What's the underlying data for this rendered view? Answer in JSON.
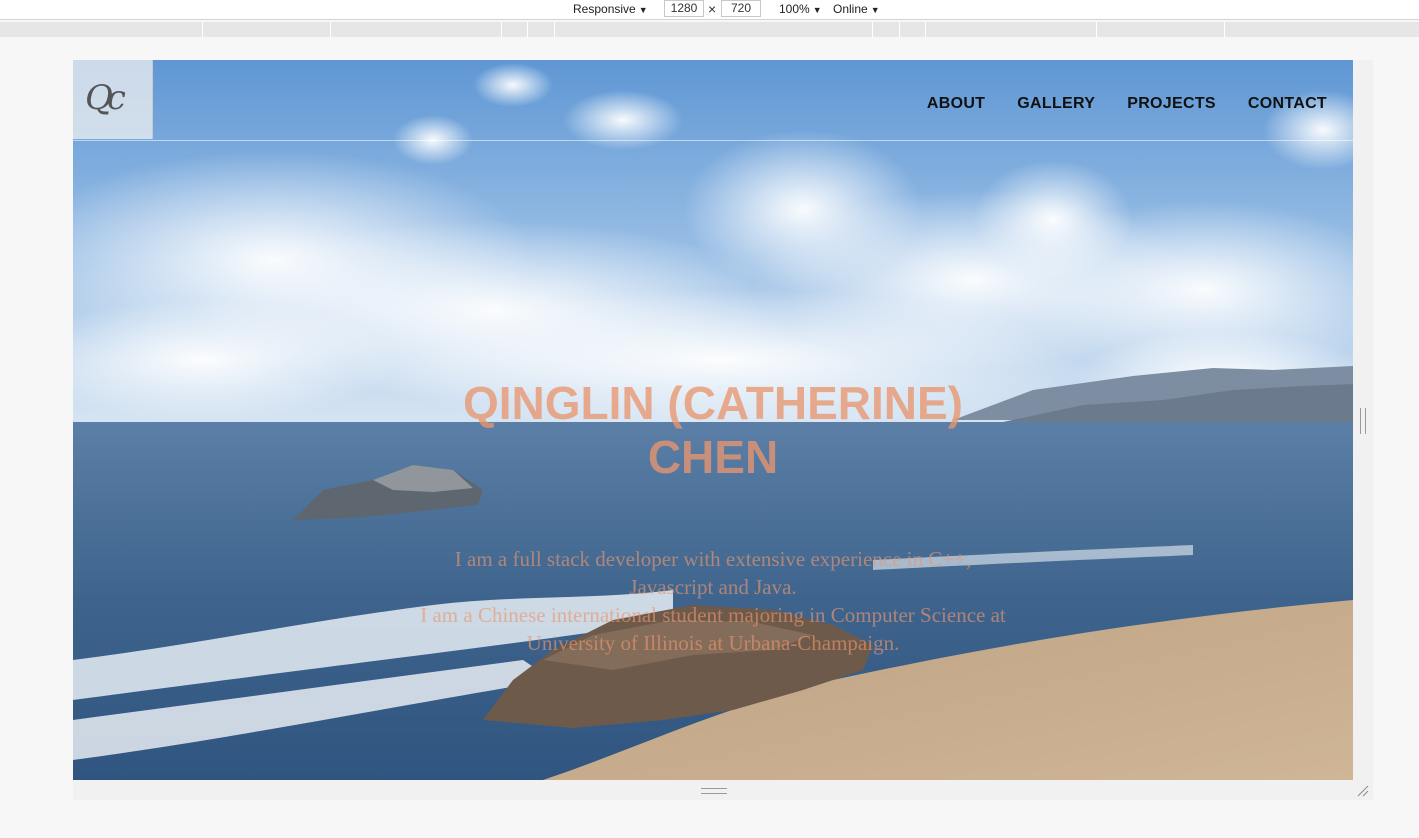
{
  "devtools": {
    "device": "Responsive",
    "width": "1280",
    "times": "×",
    "height": "720",
    "zoom": "100%",
    "network": "Online",
    "caret": "▼"
  },
  "site": {
    "logo_text": "Qc",
    "nav": [
      {
        "label": "ABOUT"
      },
      {
        "label": "GALLERY"
      },
      {
        "label": "PROJECTS"
      },
      {
        "label": "CONTACT"
      }
    ],
    "hero": {
      "title_line1": "QINGLIN (CATHERINE)",
      "title_line2": "CHEN",
      "lines": [
        "I am a full stack developer with extensive experience in C++,",
        "Javascript and Java.",
        "I am a Chinese international student majoring in Computer Science at",
        "University of Illinois at Urbana-Champaign."
      ]
    }
  },
  "colors": {
    "title": "#e8966e",
    "sky": "#6fa3d8",
    "ocean": "#3f6690",
    "sand": "#c7ad8c"
  }
}
